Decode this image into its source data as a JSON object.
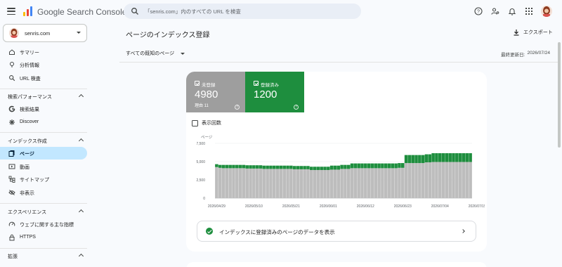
{
  "app": {
    "title": "Google Search Console"
  },
  "search": {
    "placeholder": "「senris.com」内のすべての URL を検査"
  },
  "topbar": {
    "icons": [
      "help-icon",
      "manage-accounts-icon",
      "notifications-icon",
      "apps-grid-icon",
      "account-avatar"
    ]
  },
  "property": {
    "name": "senris.com"
  },
  "sidebar": {
    "top_items": [
      {
        "label": "サマリー",
        "icon": "home-icon"
      },
      {
        "label": "分析情報",
        "icon": "lightbulb-icon"
      },
      {
        "label": "URL 検査",
        "icon": "search-icon"
      }
    ],
    "sections": [
      {
        "title": "検索パフォーマンス",
        "items": [
          {
            "label": "検索結果",
            "icon": "google-g-icon"
          },
          {
            "label": "Discover",
            "icon": "asterisk-icon"
          }
        ]
      },
      {
        "title": "インデックス作成",
        "items": [
          {
            "label": "ページ",
            "icon": "pages-icon",
            "active": true
          },
          {
            "label": "動画",
            "icon": "video-icon"
          },
          {
            "label": "サイトマップ",
            "icon": "sitemap-icon"
          },
          {
            "label": "非表示",
            "icon": "eye-off-icon"
          }
        ]
      },
      {
        "title": "エクスペリエンス",
        "items": [
          {
            "label": "ウェブに関する主な指標",
            "icon": "speed-icon"
          },
          {
            "label": "HTTPS",
            "icon": "lock-icon"
          }
        ]
      },
      {
        "title": "拡張",
        "items": []
      }
    ]
  },
  "main": {
    "title": "ページのインデックス登録",
    "export_label": "エクスポート",
    "filter_label": "すべての既知のページ",
    "updated_label": "最終更新日:",
    "updated_date": "2026/07/24",
    "tiles": {
      "not_indexed": {
        "label": "未登録",
        "value": "4980",
        "reason": "理由 11",
        "color": "#9e9e9e"
      },
      "indexed": {
        "label": "登録済み",
        "value": "1200",
        "color": "#1e8e3e"
      }
    },
    "impressions_label": "表示回数",
    "data_link_label": "インデックスに登録済みのページのデータを表示"
  },
  "chart_data": {
    "type": "bar",
    "stacked": true,
    "ylabel": "ページ",
    "ylim": [
      0,
      7500
    ],
    "yticks": [
      "7,500",
      "5,000",
      "2,500",
      "0"
    ],
    "ytick_values": [
      7500,
      5000,
      2500,
      0
    ],
    "xtick_labels": [
      "2026/04/29",
      "2026/05/10",
      "2026/05/21",
      "2026/06/01",
      "2026/06/12",
      "2026/06/23",
      "2026/07/04",
      "2026/07/15"
    ],
    "grid": true,
    "series": [
      {
        "name": "未登録",
        "color": "#bdbdbd",
        "segments": [
          {
            "from": 0,
            "to": 1,
            "value": 4250
          },
          {
            "from": 1,
            "to": 2,
            "value": 4150
          },
          {
            "from": 2,
            "to": 9,
            "value": 4100
          },
          {
            "from": 9,
            "to": 14,
            "value": 4050
          },
          {
            "from": 14,
            "to": 23,
            "value": 4000
          },
          {
            "from": 23,
            "to": 28,
            "value": 3950
          },
          {
            "from": 28,
            "to": 34,
            "value": 3850
          },
          {
            "from": 34,
            "to": 37,
            "value": 3900
          },
          {
            "from": 37,
            "to": 40,
            "value": 4000
          },
          {
            "from": 40,
            "to": 54,
            "value": 4100
          },
          {
            "from": 54,
            "to": 56,
            "value": 4150
          },
          {
            "from": 56,
            "to": 62,
            "value": 4800
          },
          {
            "from": 62,
            "to": 64,
            "value": 4900
          },
          {
            "from": 64,
            "to": 76,
            "value": 4950
          }
        ]
      },
      {
        "name": "登録済み",
        "color": "#1e8e3e",
        "segments": [
          {
            "from": 0,
            "to": 2,
            "value": 400
          },
          {
            "from": 2,
            "to": 23,
            "value": 450
          },
          {
            "from": 23,
            "to": 28,
            "value": 450
          },
          {
            "from": 28,
            "to": 34,
            "value": 450
          },
          {
            "from": 34,
            "to": 37,
            "value": 550
          },
          {
            "from": 37,
            "to": 40,
            "value": 550
          },
          {
            "from": 40,
            "to": 54,
            "value": 650
          },
          {
            "from": 54,
            "to": 56,
            "value": 650
          },
          {
            "from": 56,
            "to": 64,
            "value": 1100
          },
          {
            "from": 64,
            "to": 76,
            "value": 1200
          }
        ]
      }
    ],
    "num_days": 76
  }
}
